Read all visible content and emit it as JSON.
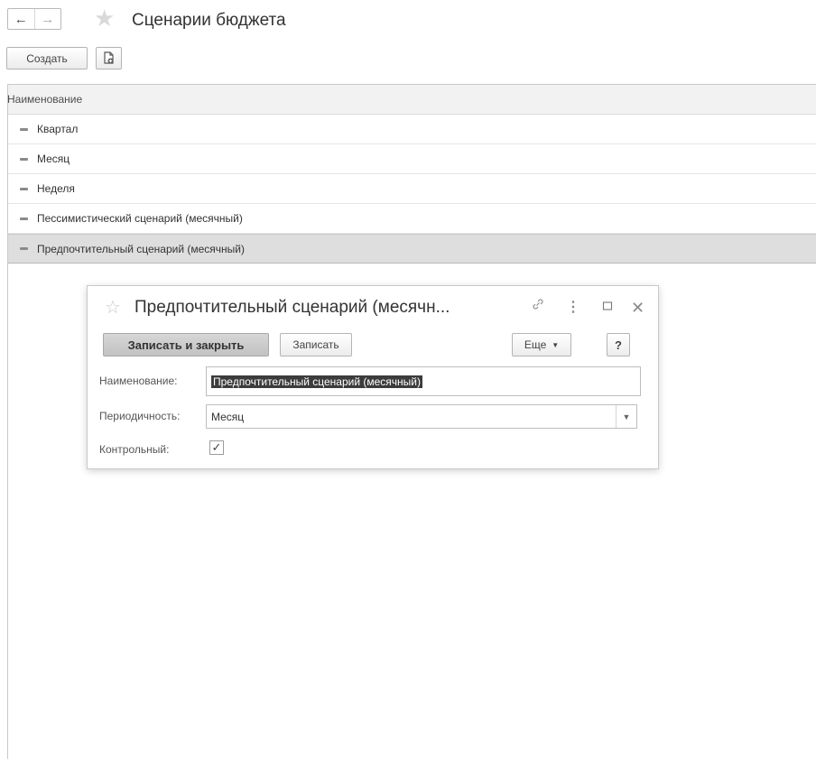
{
  "header": {
    "back_icon": "arrow-left-icon",
    "forward_icon": "arrow-right-icon",
    "favorite_icon": "star-icon",
    "title": "Сценарии бюджета"
  },
  "toolbar": {
    "create_label": "Создать",
    "copy_icon": "copy-document-icon"
  },
  "list": {
    "column_header": "Наименование",
    "items": [
      {
        "label": "Квартал"
      },
      {
        "label": "Месяц"
      },
      {
        "label": "Неделя"
      },
      {
        "label": "Пессимистический сценарий (месячный)"
      },
      {
        "label": "Предпочтительный сценарий (месячный)",
        "selected": true
      }
    ]
  },
  "dialog": {
    "title": "Предпочтительный сценарий (месячн...",
    "icons": [
      "star-icon",
      "link-icon",
      "more-vertical-icon",
      "maximize-icon",
      "close-icon"
    ],
    "save_close_label": "Записать и закрыть",
    "save_label": "Записать",
    "more_label": "Еще",
    "help_label": "?",
    "fields": {
      "name_label": "Наименование:",
      "name_value": "Предпочтительный сценарий (месячный)",
      "periodicity_label": "Периодичность:",
      "periodicity_value": "Месяц",
      "control_label": "Контрольный:",
      "control_checked": true
    }
  },
  "colors": {
    "selected_row": "#dedede",
    "header_bg": "#f2f2f2",
    "primary_button": "#c9c9c9"
  }
}
